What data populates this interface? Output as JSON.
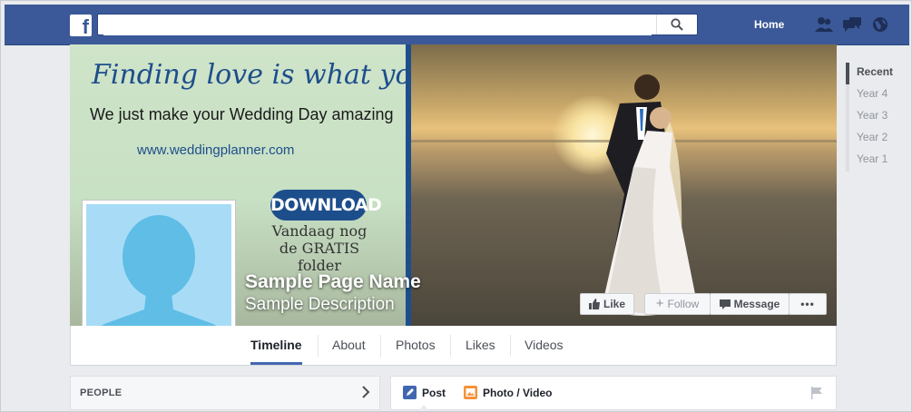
{
  "topbar": {
    "logo": "f",
    "search_placeholder": "",
    "home_label": "Home",
    "icons": [
      "friends-icon",
      "messages-icon",
      "notifications-globe-icon",
      "search-icon"
    ]
  },
  "cover": {
    "headline": "Finding love is what you do",
    "subline": "We just make your Wedding Day amazing",
    "url": "www.weddingplanner.com",
    "download_label": "DOWNLOAD",
    "promo_line1": "Vandaag nog",
    "promo_line2": "de GRATIS folder",
    "page_name": "Sample Page Name",
    "page_description": "Sample Description"
  },
  "actions": {
    "like": "Like",
    "follow": "Follow",
    "message": "Message",
    "more": "•••"
  },
  "tabs": [
    "Timeline",
    "About",
    "Photos",
    "Likes",
    "Videos"
  ],
  "years": [
    "Recent",
    "Year 4",
    "Year 3",
    "Year 2",
    "Year 1"
  ],
  "people": {
    "title": "PEOPLE"
  },
  "composer": {
    "post_label": "Post",
    "photo_label": "Photo / Video"
  },
  "colors": {
    "facebook_blue": "#3b5998",
    "brand_blue": "#1d4e8c",
    "avatar_blue": "#a8dcf6"
  }
}
